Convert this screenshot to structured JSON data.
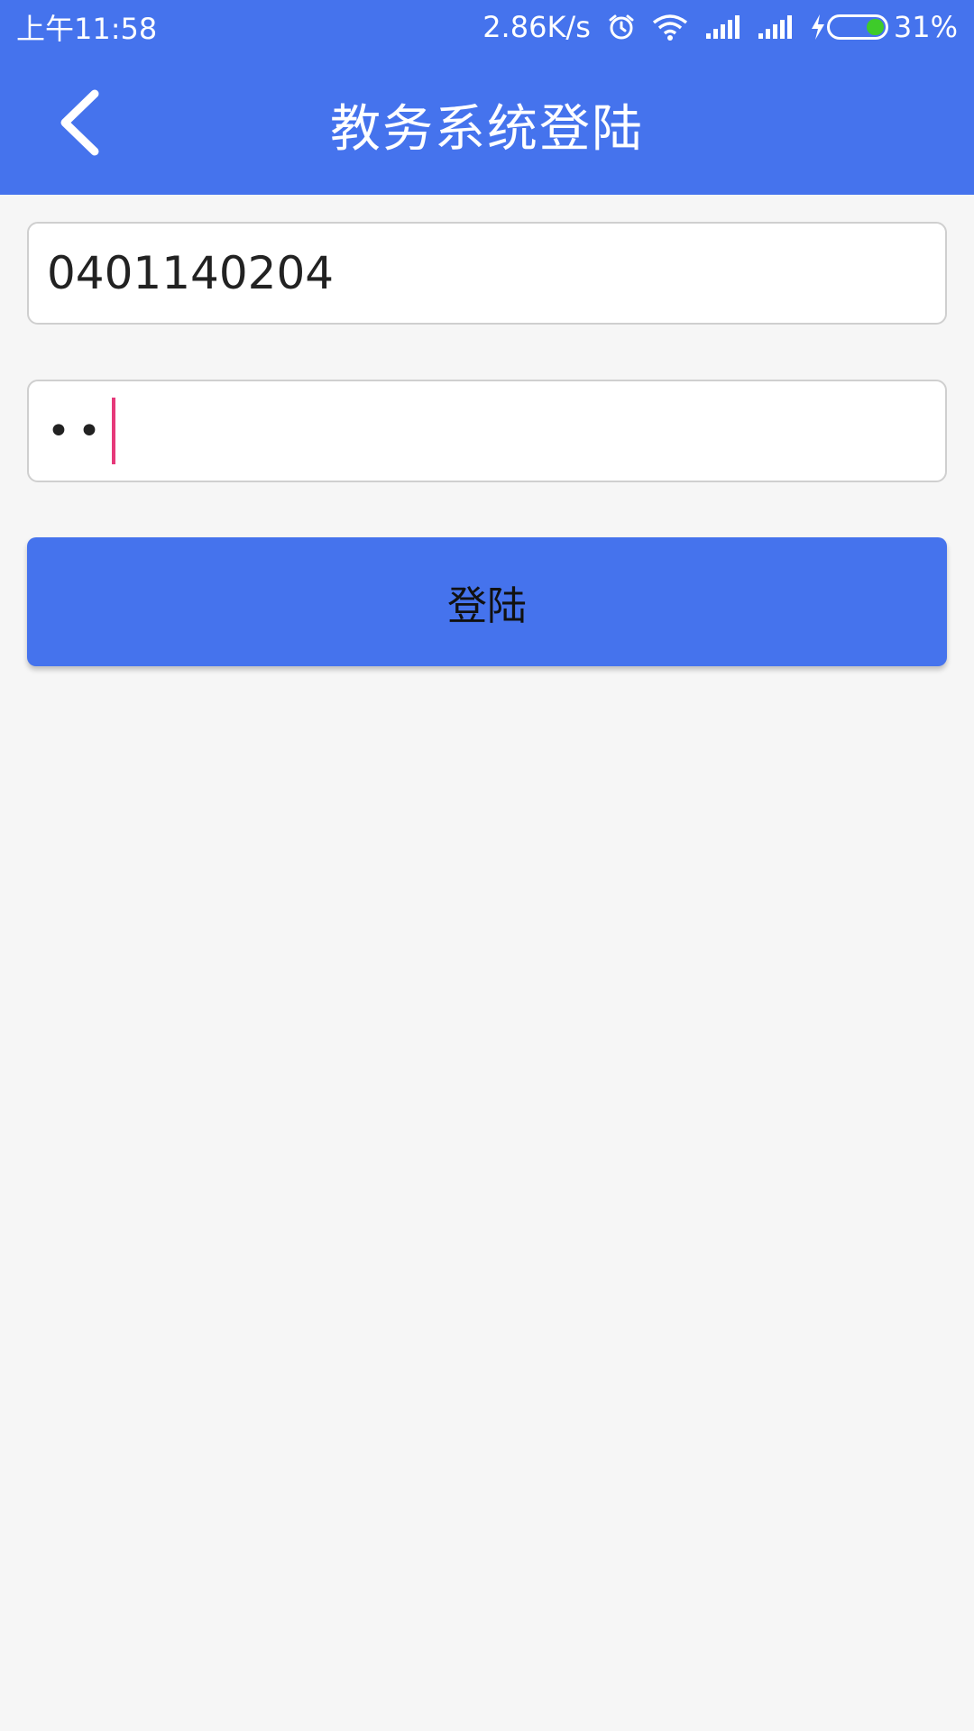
{
  "status_bar": {
    "time": "上午11:58",
    "net_speed": "2.86K/s",
    "battery": "31%",
    "battery_level": 0.31,
    "icons": [
      "alarm-icon",
      "wifi-icon",
      "signal-icon",
      "signal-icon",
      "charging-icon",
      "battery-icon"
    ]
  },
  "header": {
    "title": "教务系统登陆",
    "back_icon": "chevron-left-icon"
  },
  "form": {
    "username_value": "0401140204",
    "password_mask": "••"
  },
  "login_button": {
    "label": "登陆"
  },
  "colors": {
    "primary": "#4573ed",
    "background": "#f6f6f6",
    "caret": "#e6397a",
    "battery_fill": "#3ecb2a"
  }
}
